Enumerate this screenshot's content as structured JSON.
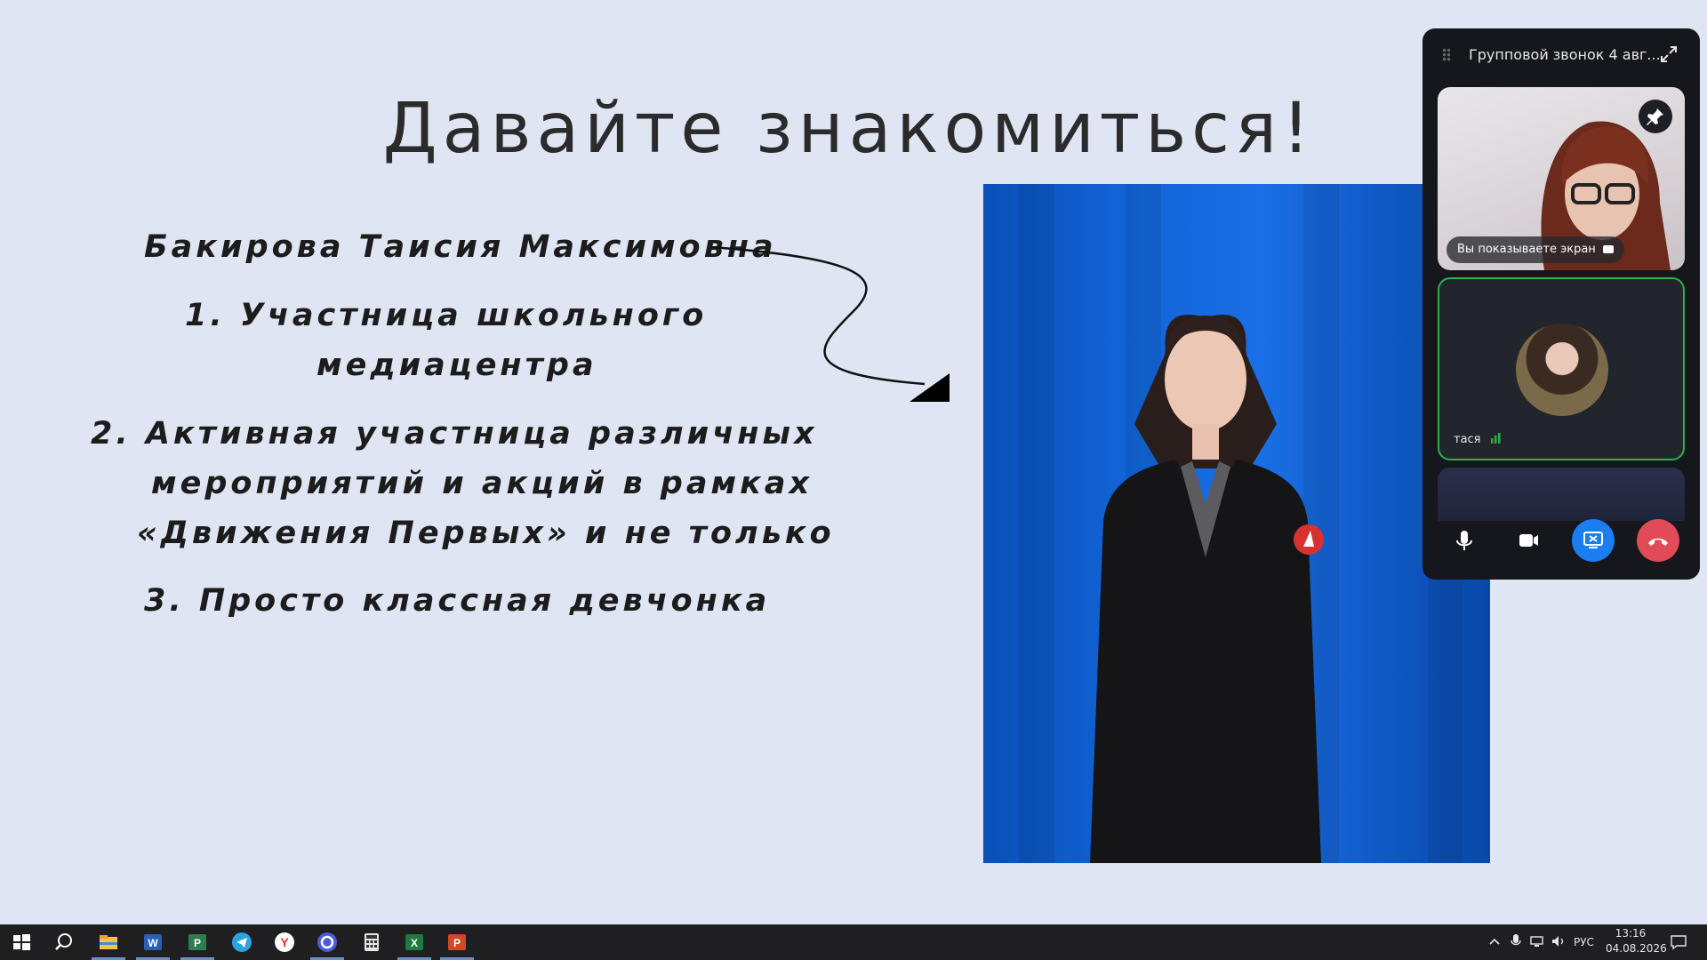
{
  "slide": {
    "title": "Давайте знакомиться!",
    "name": "Бакирова Таисия Максимовна",
    "item1_line1": "1.  Участница школьного",
    "item1_line2": "медиацентра",
    "item2_line1": "2.  Активная участница различных",
    "item2_line2": "мероприятий и акций в рамках",
    "item2_line3": "«Движения Первых» и не только",
    "item3": "3.  Просто классная девчонка"
  },
  "call": {
    "title": "Групповой звонок 4 авг...",
    "screen_badge": "Вы показываете экран",
    "participant_name": "тася",
    "colors": {
      "share": "#1a7df0",
      "end": "#e04b57",
      "speaking": "#2bb04a"
    }
  },
  "taskbar": {
    "language": "РУС",
    "time": "13:16",
    "date": "04.08.2026",
    "apps": [
      "windows-start",
      "search",
      "file-explorer",
      "word",
      "project",
      "telegram",
      "yandex",
      "browser-q",
      "calculator",
      "excel",
      "powerpoint"
    ]
  }
}
